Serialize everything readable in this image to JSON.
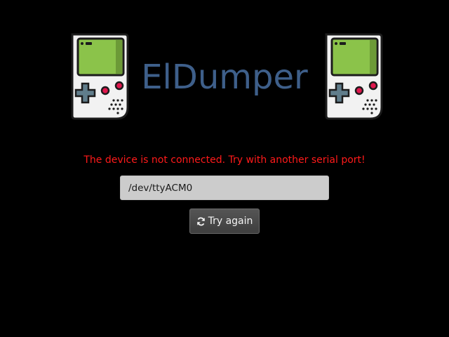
{
  "app": {
    "title": "ElDumper",
    "logo_icon": "gameboy-icon"
  },
  "status": {
    "error_message": "The device is not connected. Try with another serial port!",
    "error_color": "#ff1a1a"
  },
  "port_input": {
    "value": "/dev/ttyACM0"
  },
  "retry_button": {
    "label": "Try again",
    "icon": "refresh-icon"
  },
  "colors": {
    "background": "#000000",
    "title": "#3e5f8a",
    "gameboy_screen": "#8bc34a"
  }
}
